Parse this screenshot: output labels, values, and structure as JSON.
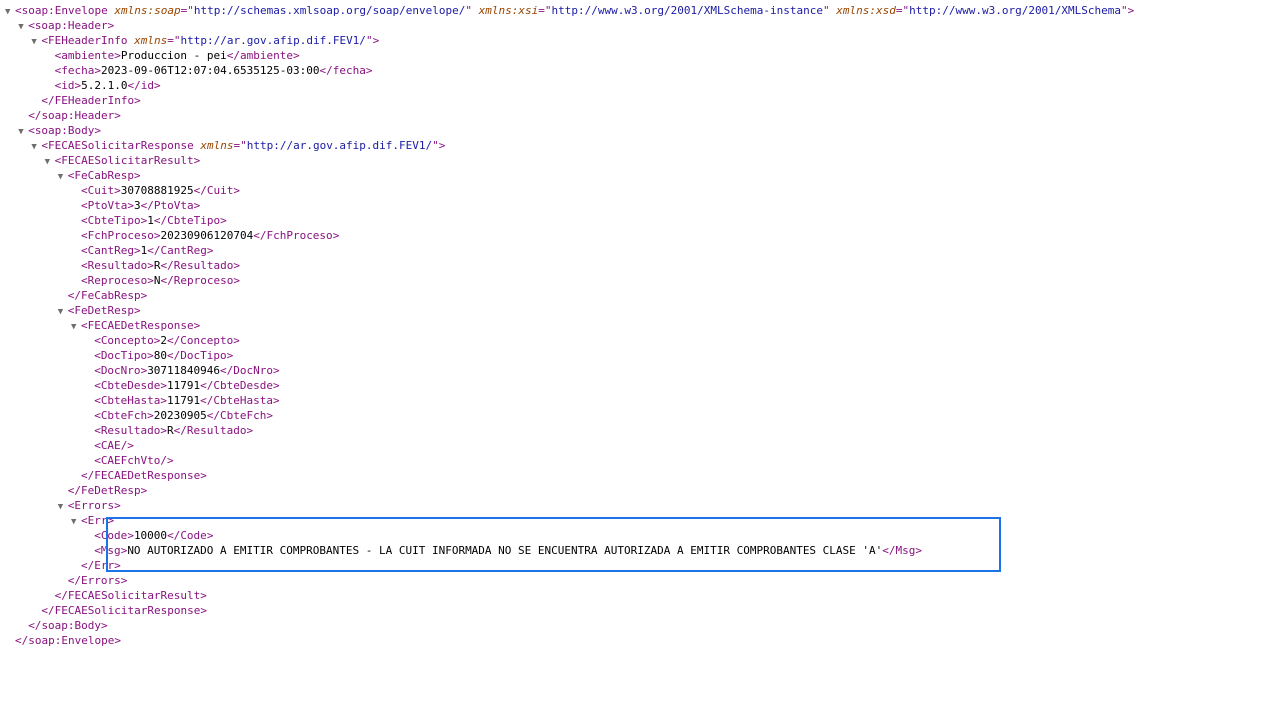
{
  "highlight_color": "#1a73e8",
  "lines": [
    {
      "indent": 0,
      "toggle": true,
      "name": "soap:Envelope",
      "open": true,
      "attrs": [
        {
          "n": "xmlns:soap",
          "v": "http://schemas.xmlsoap.org/soap/envelope/"
        },
        {
          "n": "xmlns:xsi",
          "v": "http://www.w3.org/2001/XMLSchema-instance"
        },
        {
          "n": "xmlns:xsd",
          "v": "http://www.w3.org/2001/XMLSchema"
        }
      ]
    },
    {
      "indent": 1,
      "toggle": true,
      "name": "soap:Header",
      "open": true
    },
    {
      "indent": 2,
      "toggle": true,
      "name": "FEHeaderInfo",
      "open": true,
      "attrs": [
        {
          "n": "xmlns",
          "v": "http://ar.gov.afip.dif.FEV1/"
        }
      ]
    },
    {
      "indent": 3,
      "name": "ambiente",
      "text": "Produccion - pei"
    },
    {
      "indent": 3,
      "name": "fecha",
      "text": "2023-09-06T12:07:04.6535125-03:00"
    },
    {
      "indent": 3,
      "name": "id",
      "text": "5.2.1.0"
    },
    {
      "indent": 2,
      "name": "FEHeaderInfo",
      "close": true
    },
    {
      "indent": 1,
      "name": "soap:Header",
      "close": true
    },
    {
      "indent": 1,
      "toggle": true,
      "name": "soap:Body",
      "open": true
    },
    {
      "indent": 2,
      "toggle": true,
      "name": "FECAESolicitarResponse",
      "open": true,
      "attrs": [
        {
          "n": "xmlns",
          "v": "http://ar.gov.afip.dif.FEV1/"
        }
      ]
    },
    {
      "indent": 3,
      "toggle": true,
      "name": "FECAESolicitarResult",
      "open": true
    },
    {
      "indent": 4,
      "toggle": true,
      "name": "FeCabResp",
      "open": true
    },
    {
      "indent": 5,
      "name": "Cuit",
      "text": "30708881925"
    },
    {
      "indent": 5,
      "name": "PtoVta",
      "text": "3"
    },
    {
      "indent": 5,
      "name": "CbteTipo",
      "text": "1"
    },
    {
      "indent": 5,
      "name": "FchProceso",
      "text": "20230906120704"
    },
    {
      "indent": 5,
      "name": "CantReg",
      "text": "1"
    },
    {
      "indent": 5,
      "name": "Resultado",
      "text": "R"
    },
    {
      "indent": 5,
      "name": "Reproceso",
      "text": "N"
    },
    {
      "indent": 4,
      "name": "FeCabResp",
      "close": true
    },
    {
      "indent": 4,
      "toggle": true,
      "name": "FeDetResp",
      "open": true
    },
    {
      "indent": 5,
      "toggle": true,
      "name": "FECAEDetResponse",
      "open": true
    },
    {
      "indent": 6,
      "name": "Concepto",
      "text": "2"
    },
    {
      "indent": 6,
      "name": "DocTipo",
      "text": "80"
    },
    {
      "indent": 6,
      "name": "DocNro",
      "text": "30711840946"
    },
    {
      "indent": 6,
      "name": "CbteDesde",
      "text": "11791"
    },
    {
      "indent": 6,
      "name": "CbteHasta",
      "text": "11791"
    },
    {
      "indent": 6,
      "name": "CbteFch",
      "text": "20230905"
    },
    {
      "indent": 6,
      "name": "Resultado",
      "text": "R"
    },
    {
      "indent": 6,
      "name": "CAE",
      "selfclose": true
    },
    {
      "indent": 6,
      "name": "CAEFchVto",
      "selfclose": true
    },
    {
      "indent": 5,
      "name": "FECAEDetResponse",
      "close": true
    },
    {
      "indent": 4,
      "name": "FeDetResp",
      "close": true
    },
    {
      "indent": 4,
      "toggle": true,
      "name": "Errors",
      "open": true
    },
    {
      "indent": 5,
      "toggle": true,
      "name": "Err",
      "open": true
    },
    {
      "indent": 6,
      "name": "Code",
      "text": "10000"
    },
    {
      "indent": 6,
      "name": "Msg",
      "text": "NO AUTORIZADO A EMITIR COMPROBANTES - LA CUIT INFORMADA NO SE ENCUENTRA AUTORIZADA A EMITIR COMPROBANTES CLASE 'A'"
    },
    {
      "indent": 5,
      "name": "Err",
      "close": true
    },
    {
      "indent": 4,
      "name": "Errors",
      "close": true
    },
    {
      "indent": 3,
      "name": "FECAESolicitarResult",
      "close": true
    },
    {
      "indent": 2,
      "name": "FECAESolicitarResponse",
      "close": true
    },
    {
      "indent": 1,
      "name": "soap:Body",
      "close": true
    },
    {
      "indent": 0,
      "name": "soap:Envelope",
      "close": true
    }
  ]
}
